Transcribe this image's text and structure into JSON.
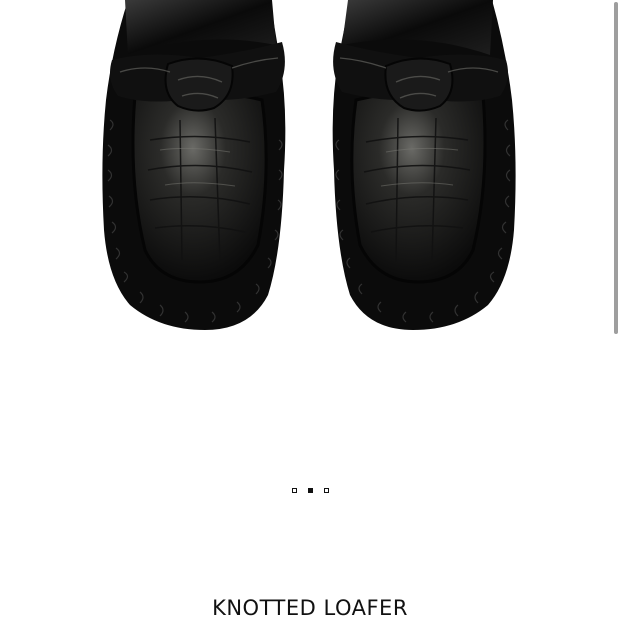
{
  "product": {
    "title": "KNOTTED LOAFER",
    "image_description_icon": "loafer-pair-image"
  },
  "carousel": {
    "total_slides": 3,
    "active_index": 1
  },
  "colors": {
    "background": "#ffffff",
    "text": "#111111",
    "shoe": "#0c0c0c",
    "scrollbar": "#9e9e9e"
  }
}
